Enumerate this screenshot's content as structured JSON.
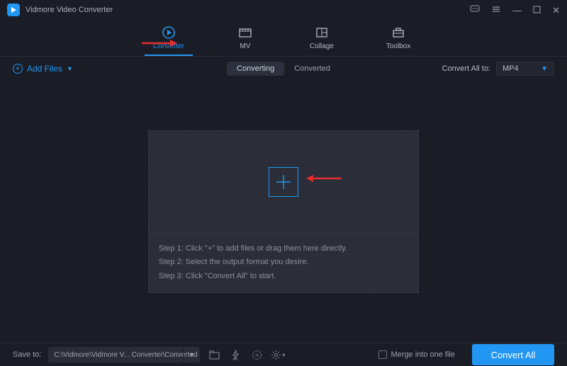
{
  "app": {
    "title": "Vidmore Video Converter"
  },
  "nav": [
    {
      "label": "Converter",
      "active": true
    },
    {
      "label": "MV",
      "active": false
    },
    {
      "label": "Collage",
      "active": false
    },
    {
      "label": "Toolbox",
      "active": false
    }
  ],
  "toolbar": {
    "add_files": "Add Files",
    "tabs": {
      "converting": "Converting",
      "converted": "Converted",
      "active": "converting"
    },
    "convert_all_to_label": "Convert All to:",
    "format_selected": "MP4"
  },
  "dropzone": {
    "steps": [
      "Step 1: Click \"+\" to add files or drag them here directly.",
      "Step 2: Select the output format you desire.",
      "Step 3: Click \"Convert All\" to start."
    ]
  },
  "footer": {
    "save_to_label": "Save to:",
    "output_path": "C:\\Vidmore\\Vidmore V... Converter\\Converted",
    "merge_label": "Merge into one file",
    "convert_button": "Convert All"
  }
}
